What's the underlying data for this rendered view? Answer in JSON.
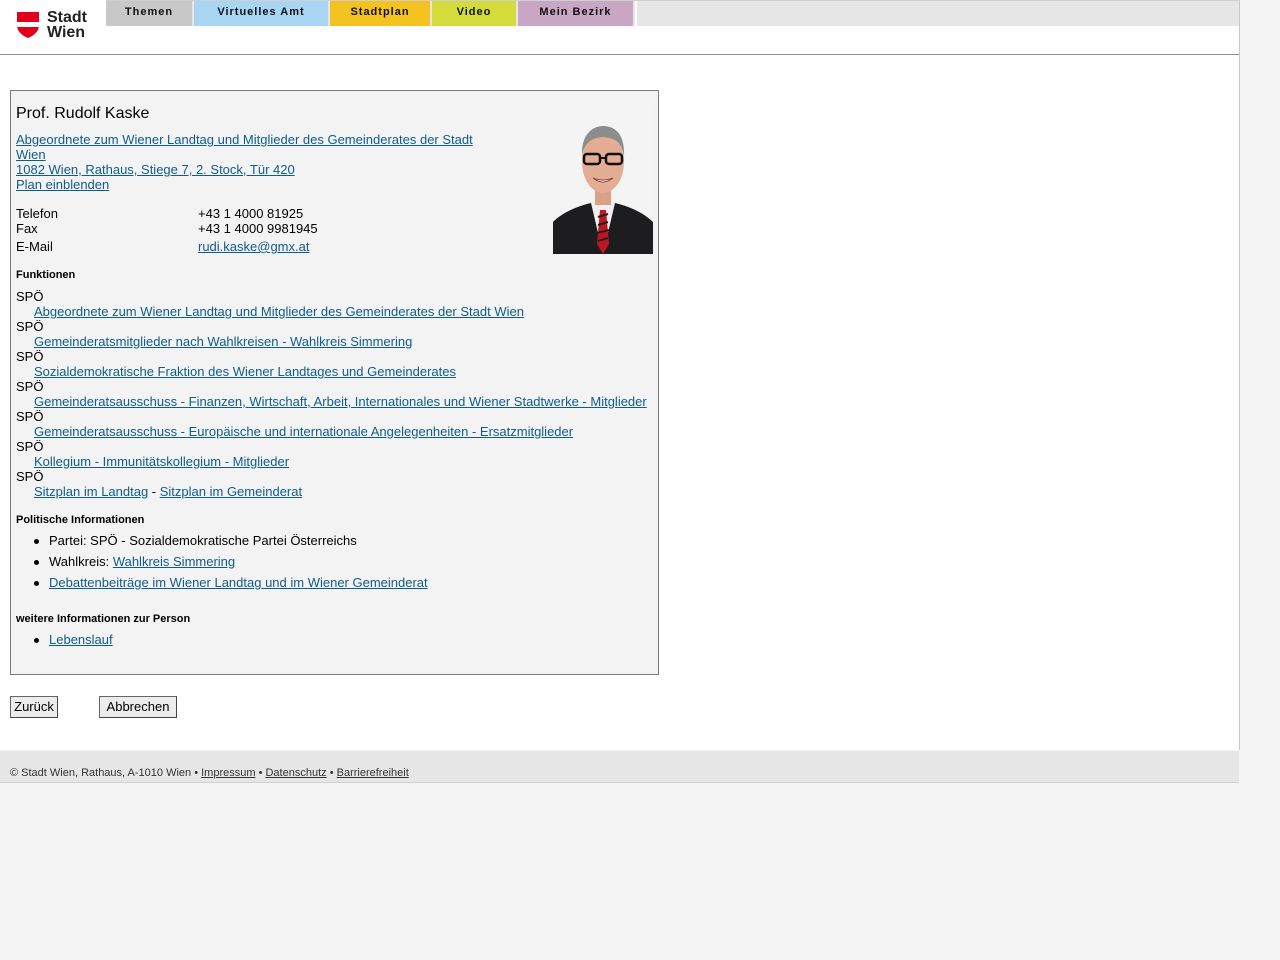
{
  "header": {
    "logo_text_line1": "Stadt",
    "logo_text_line2": "Wien",
    "logo_colors": {
      "shield": "#e2001a"
    },
    "tabs": [
      {
        "label": "Themen",
        "color": "#c8c8c8"
      },
      {
        "label": "Virtuelles Amt",
        "color": "#a7d5f2"
      },
      {
        "label": "Stadtplan",
        "color": "#f5c320"
      },
      {
        "label": "Video",
        "color": "#d4dc3c"
      },
      {
        "label": "Mein Bezirk",
        "color": "#c9a6c3"
      }
    ]
  },
  "person": {
    "name": "Prof. Rudolf Kaske",
    "role_link_line1": "Abgeordnete zum Wiener Landtag und Mitglieder des Gemeinderates der Stadt",
    "role_link_line2": "Wien ",
    "address_link": "1082 Wien, Rathaus, Stiege 7, 2. Stock, Tür 420",
    "plan_link": "Plan einblenden",
    "photo_icon": "portrait-photo",
    "contacts": [
      {
        "label": "Telefon",
        "value": "+43 1 4000 81925"
      },
      {
        "label": "Fax",
        "value": "+43 1 4000 9981945"
      },
      {
        "label": "E-Mail",
        "value": "rudi.kaske@gmx.at"
      }
    ]
  },
  "functions": {
    "heading": "Funktionen",
    "items": [
      {
        "party": "SPÖ",
        "link": "Abgeordnete zum Wiener Landtag und Mitglieder des Gemeinderates der Stadt Wien"
      },
      {
        "party": "SPÖ",
        "link": "Gemeinderatsmitglieder nach Wahlkreisen - Wahlkreis Simmering"
      },
      {
        "party": "SPÖ",
        "link": "Sozialdemokratische Fraktion des Wiener Landtages und Gemeinderates"
      },
      {
        "party": "SPÖ",
        "link": "Gemeinderatsausschuss - Finanzen, Wirtschaft, Arbeit, Internationales und Wiener Stadtwerke - Mitglieder"
      },
      {
        "party": "SPÖ",
        "link": "Gemeinderatsausschuss - Europäische und internationale Angelegenheiten - Ersatzmitglieder"
      },
      {
        "party": "SPÖ",
        "link": "Kollegium - Immunitätskollegium - Mitglieder"
      }
    ],
    "last_party": "SPÖ",
    "seat_link_1": "Sitzplan im Landtag",
    "seat_sep": " - ",
    "seat_link_2": "Sitzplan im Gemeinderat"
  },
  "political": {
    "heading": "Politische Informationen",
    "party_text": "Partei: SPÖ - Sozialdemokratische Partei Österreichs",
    "wahlkreis_label": "Wahlkreis: ",
    "wahlkreis_link": "Wahlkreis Simmering",
    "debates_link": "Debattenbeiträge im Wiener Landtag und im Wiener Gemeinderat"
  },
  "more": {
    "heading": "weitere Informationen zur Person",
    "cv_link": "Lebenslauf"
  },
  "buttons": {
    "back": "Zurück",
    "cancel": "Abbrechen"
  },
  "footer": {
    "copyright": "© Stadt Wien, Rathaus, A-1010 Wien • ",
    "impressum": "Impressum",
    "sep1": " • ",
    "datenschutz": "Datenschutz",
    "sep2": " • ",
    "barrierefreiheit": "Barrierefreiheit"
  }
}
